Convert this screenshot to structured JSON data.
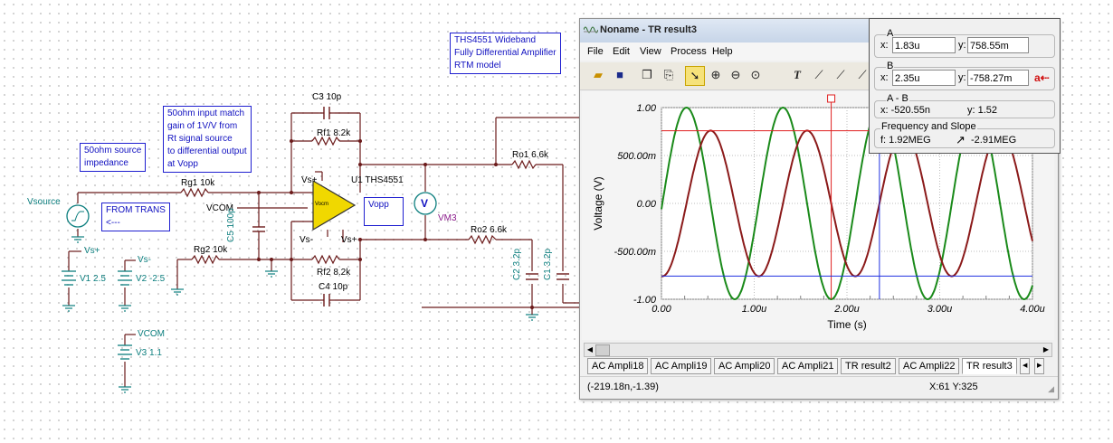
{
  "schematic": {
    "notes": {
      "model": [
        "THS4551 Wideband",
        "Fully Differential Amplifier",
        "RTM model"
      ],
      "match": [
        "50ohm input match",
        "gain of 1V/V from",
        "Rt signal source",
        "to differential output",
        "at Vopp"
      ],
      "source_imp": [
        "50ohm source",
        "impedance"
      ],
      "from_trans": [
        "FROM TRANS",
        "<---"
      ],
      "vopp": "Vopp"
    },
    "labels": {
      "c3": "C3 10p",
      "rf1": "Rf1 8.2k",
      "rg1": "Rg1 10k",
      "vsource": "Vsource",
      "vcom1": "VCOM",
      "c5": "C5 100p",
      "u1": "U1 THS4551",
      "vs_plus_top": "Vs+",
      "vs_minus": "Vs-",
      "vs_plus_bot": "Vs+",
      "rg2": "Rg2 10k",
      "rf2": "Rf2 8.2k",
      "c4": "C4 10p",
      "ro1": "Ro1 6.6k",
      "ro2": "Ro2 6.6k",
      "vm3": "VM3",
      "vm_symbol": "V",
      "c2": "C2 3.2p",
      "c1": "C1 3.2p",
      "v1_top": "Vs+",
      "v1": "V1 2.5",
      "v2_top": "Vs-",
      "v2": "V2 -2.5",
      "v3_top": "VCOM",
      "v3": "V3 1.1",
      "opamp_vocm": "Vocm"
    }
  },
  "window": {
    "title": "Noname - TR result3",
    "menu": [
      "File",
      "Edit",
      "View",
      "Process",
      "Help"
    ],
    "toolbar_icons": [
      "open-icon",
      "save-icon",
      "copy-icon",
      "paste-icon",
      "pointer-icon",
      "zoom-in-icon",
      "zoom-out-icon",
      "zoom-100-icon",
      "text-icon",
      "draw-curve-icon",
      "draw-curve2-icon",
      "draw-curve3-icon"
    ],
    "tabs": [
      "AC Ampli18",
      "AC Ampli19",
      "AC Ampli20",
      "AC Ampli21",
      "TR result2",
      "AC Ampli22",
      "TR result3"
    ],
    "active_tab": "TR result3",
    "status_coords": "(-219.18n,-1.39)",
    "status_xy": "X:61  Y:325"
  },
  "cursor_panel": {
    "a_title": "A",
    "a_x_label": "x:",
    "a_x": "1.83u",
    "a_y_label": "y:",
    "a_y": "758.55m",
    "b_title": "B",
    "b_x_label": "x:",
    "b_x": "2.35u",
    "b_y_label": "y:",
    "b_y": "-758.27m",
    "ab_title": "A - B",
    "ab_x": "x:  -520.55n",
    "ab_y": "y:  1.52",
    "fs_title": "Frequency and Slope",
    "f": "f:  1.92MEG",
    "slope": "-2.91MEG"
  },
  "chart_data": {
    "type": "line",
    "xlabel": "Time (s)",
    "ylabel": "Voltage (V)",
    "xlim": [
      0,
      4.0
    ],
    "ylim": [
      -1.0,
      1.0
    ],
    "x_unit": "u",
    "x_ticks": [
      "0.00",
      "1.00u",
      "2.00u",
      "3.00u",
      "4.00u"
    ],
    "y_ticks": [
      "1.00",
      "500.00m",
      "0.00",
      "-500.00m",
      "-1.00"
    ],
    "grid": true,
    "series": [
      {
        "color": "#1a8a1a",
        "kind": "sine",
        "amplitude": 1.0,
        "period_us": 1.04,
        "peak_at_us": 0.27
      },
      {
        "color": "#8b1a1a",
        "kind": "sine",
        "amplitude": 0.76,
        "period_us": 1.04,
        "peak_at_us": 0.53
      }
    ],
    "cursor_a": {
      "x": 1.83,
      "y": 0.7586,
      "color": "#e02020"
    },
    "cursor_b": {
      "x": 2.35,
      "y": -0.7583,
      "color": "#2030e0"
    }
  }
}
